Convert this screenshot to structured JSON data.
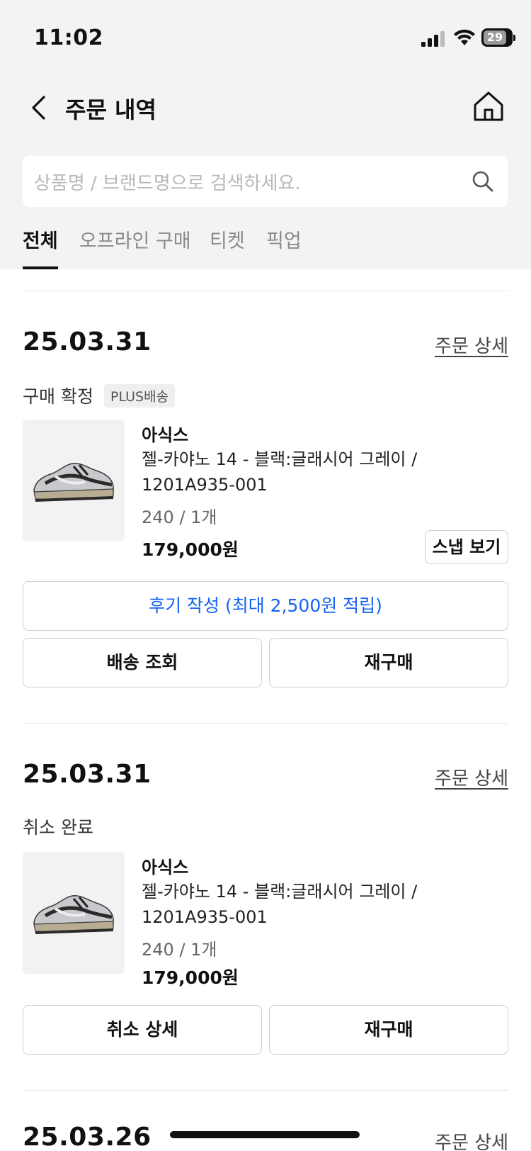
{
  "status_bar": {
    "time": "11:02",
    "battery": "29"
  },
  "header": {
    "title": "주문 내역"
  },
  "search": {
    "placeholder": "상품명 / 브랜드명으로 검색하세요."
  },
  "tabs": [
    {
      "label": "전체",
      "active": true
    },
    {
      "label": "오프라인 구매",
      "active": false
    },
    {
      "label": "티켓",
      "active": false
    },
    {
      "label": "픽업",
      "active": false
    }
  ],
  "orders": [
    {
      "date": "25.03.31",
      "detail_label": "주문 상세",
      "status": "구매 확정",
      "badge": "PLUS배송",
      "brand": "아식스",
      "product_name": "젤-카야노 14 - 블랙:글래시어 그레이 / 1201A935-001",
      "option": "240 / 1개",
      "price": "179,000원",
      "snap_label": "스냅 보기",
      "review_label": "후기 작성 (최대 2,500원 적립)",
      "button_left": "배송 조회",
      "button_right": "재구매"
    },
    {
      "date": "25.03.31",
      "detail_label": "주문 상세",
      "status": "취소 완료",
      "brand": "아식스",
      "product_name": "젤-카야노 14 - 블랙:글래시어 그레이 / 1201A935-001",
      "option": "240 / 1개",
      "price": "179,000원",
      "button_left": "취소 상세",
      "button_right": "재구매"
    },
    {
      "date": "25.03.26",
      "detail_label": "주문 상세"
    }
  ],
  "colors": {
    "accent_blue": "#1463f3",
    "header_bg": "#f3f3f3"
  }
}
